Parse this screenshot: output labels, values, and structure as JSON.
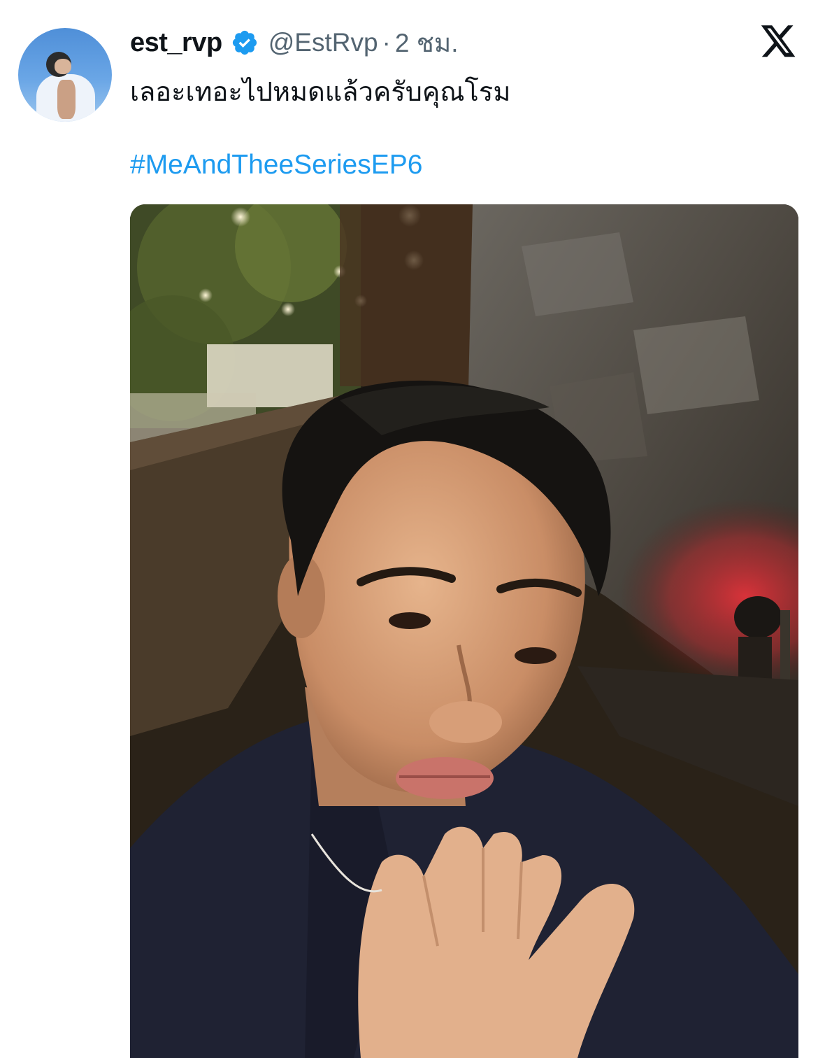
{
  "tweet": {
    "display_name": "est_rvp",
    "handle": "@EstRvp",
    "separator": "·",
    "time": "2 ชม.",
    "text": "เลอะเทอะไปหมดแล้วครับคุณโรม",
    "hashtag": "#MeAndTheeSeriesEP6"
  },
  "icons": {
    "verified": "verified-badge-icon",
    "platform": "x-logo-icon"
  },
  "colors": {
    "hashtag": "#1d9bf0",
    "verified": "#1d9bf0",
    "secondary_text": "#536471"
  },
  "media": {
    "kind": "photo"
  }
}
